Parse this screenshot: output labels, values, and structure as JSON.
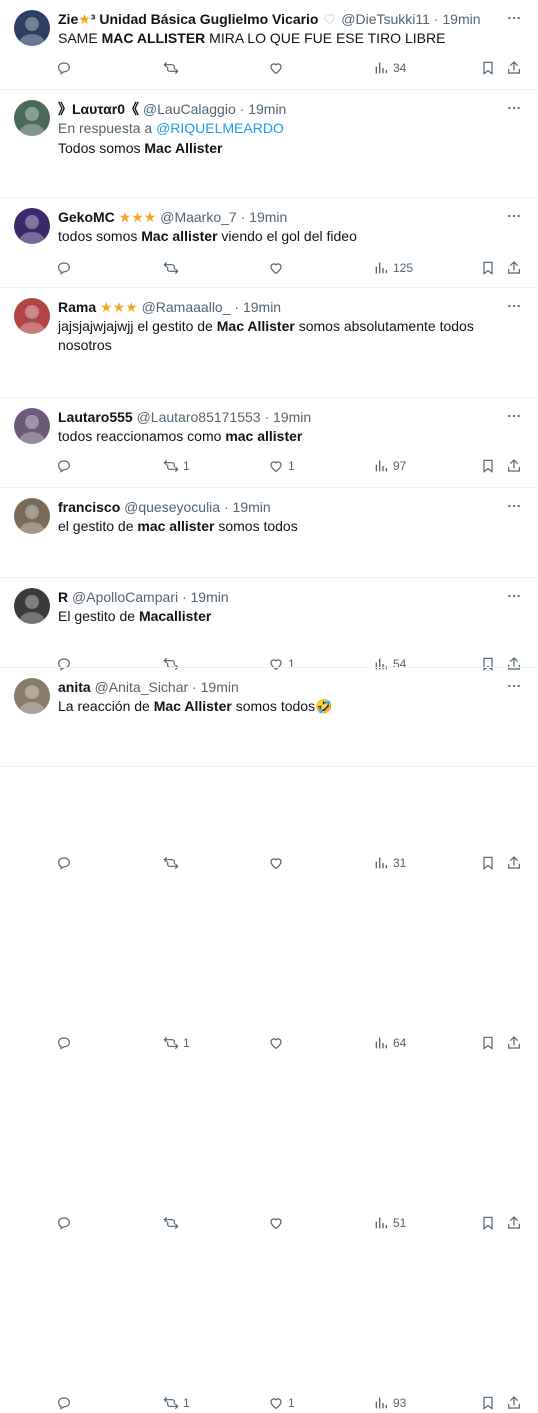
{
  "tweets": [
    {
      "name": "Zie",
      "name_suffix": "³ Unidad Básica Guglielmo Vicario",
      "stars": 1,
      "heart_badge": true,
      "handle": "@DieTsukki11",
      "time": "19min",
      "reply_prefix": "",
      "reply_handle": "",
      "text_parts": [
        "SAME ",
        "MAC ALLISTER",
        " MIRA LO QUE FUE ESE TIRO LIBRE"
      ],
      "text_parts_2": [],
      "replies": "",
      "retweets": "",
      "likes": "",
      "views": "34",
      "avatar_color": "#2d3e63"
    },
    {
      "name": "》Lαυταr0《",
      "name_suffix": "",
      "stars": 0,
      "heart_badge": false,
      "handle": "@LauCalaggio",
      "time": "19min",
      "reply_prefix": "En respuesta a ",
      "reply_handle": "@RIQUELMEARDO",
      "text_parts": [
        "Todos somos ",
        "Mac Allister",
        ""
      ],
      "text_parts_2": [],
      "replies": "",
      "retweets": "",
      "likes": "",
      "views": "125",
      "avatar_color": "#4a6a5a"
    },
    {
      "name": "GekoMC",
      "name_suffix": "",
      "stars": 3,
      "heart_badge": false,
      "handle": "@Maarko_7",
      "time": "19min",
      "reply_prefix": "",
      "reply_handle": "",
      "text_parts": [
        "todos somos ",
        "Mac allister",
        " viendo el gol del fideo"
      ],
      "text_parts_2": [],
      "replies": "",
      "retweets": "1",
      "likes": "1",
      "views": "97",
      "avatar_color": "#3b2a6b"
    },
    {
      "name": "Rama",
      "name_suffix": "",
      "stars": 3,
      "heart_badge": false,
      "handle": "@Ramaaallo_",
      "time": "19min",
      "reply_prefix": "",
      "reply_handle": "",
      "text_parts": [
        "jajsjajwjajwjj el gestito de ",
        "Mac Allister",
        " somos absolutamente todos"
      ],
      "text_parts_2": [
        "nosotros"
      ],
      "replies": "",
      "retweets": "",
      "likes": "1",
      "views": "54",
      "avatar_color": "#b04545"
    },
    {
      "name": "Lautaro555",
      "name_suffix": "",
      "stars": 0,
      "heart_badge": false,
      "handle": "@Lautaro85171553",
      "time": "19min",
      "reply_prefix": "",
      "reply_handle": "",
      "text_parts": [
        "todos reaccionamos como ",
        "mac allister",
        ""
      ],
      "text_parts_2": [],
      "replies": "",
      "retweets": "",
      "likes": "",
      "views": "31",
      "avatar_color": "#6b5a7a"
    },
    {
      "name": "francisco",
      "name_suffix": "",
      "stars": 0,
      "heart_badge": false,
      "handle": "@queseyoculia",
      "time": "19min",
      "reply_prefix": "",
      "reply_handle": "",
      "text_parts": [
        "el gestito de ",
        "mac allister",
        " somos todos"
      ],
      "text_parts_2": [],
      "replies": "",
      "retweets": "1",
      "likes": "",
      "views": "64",
      "avatar_color": "#7a6a55"
    },
    {
      "name": "R",
      "name_suffix": "",
      "stars": 0,
      "heart_badge": false,
      "handle": "@ApolloCampari",
      "time": "19min",
      "reply_prefix": "",
      "reply_handle": "",
      "text_parts": [
        "El gestito de ",
        "Macallister",
        ""
      ],
      "text_parts_2": [],
      "replies": "",
      "retweets": "",
      "likes": "",
      "views": "51",
      "avatar_color": "#3a3a3a"
    },
    {
      "name": "anita",
      "name_suffix": "",
      "stars": 0,
      "heart_badge": false,
      "handle": "@Anita_Sichar",
      "time": "19min",
      "reply_prefix": "",
      "reply_handle": "",
      "text_parts": [
        "La reacción de ",
        "Mac Allister",
        " somos todos🤣"
      ],
      "text_parts_2": [],
      "replies": "",
      "retweets": "1",
      "likes": "1",
      "views": "93",
      "avatar_color": "#8a7a6a"
    }
  ],
  "colors": {
    "text": "#0f1419",
    "muted": "#536471",
    "link": "#1d9bf0",
    "star": "#f5a623",
    "divider": "#eff3f4"
  },
  "icons": {
    "reply": "reply-icon",
    "retweet": "retweet-icon",
    "like": "heart-icon",
    "views": "views-icon",
    "bookmark": "bookmark-icon",
    "share": "share-icon",
    "more": "more-icon"
  }
}
